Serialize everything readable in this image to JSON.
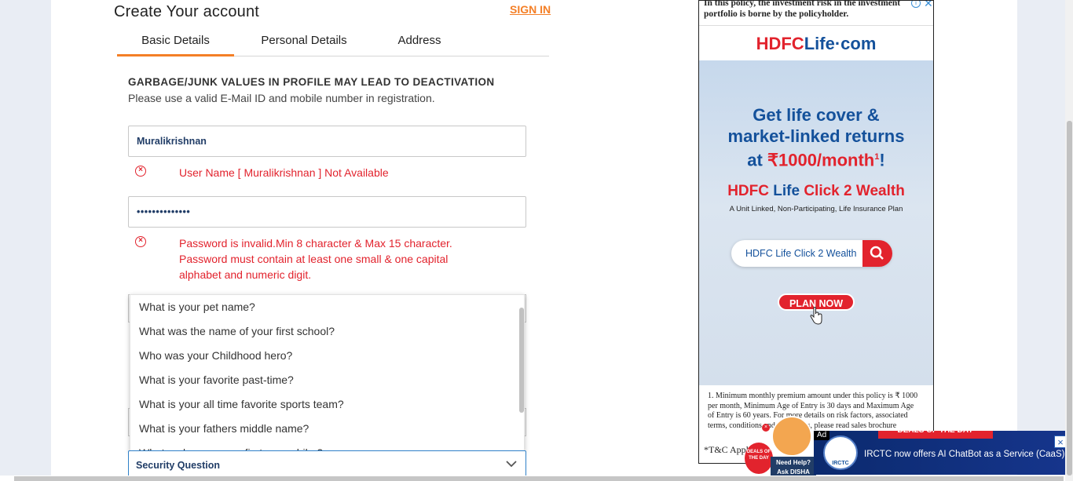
{
  "header": {
    "title": "Create Your account",
    "signin_label": "SIGN IN"
  },
  "tabs": [
    {
      "label": "Basic Details",
      "active": true
    },
    {
      "label": "Personal Details",
      "active": false
    },
    {
      "label": "Address",
      "active": false
    }
  ],
  "notice": {
    "heading": "GARBAGE/JUNK VALUES IN PROFILE MAY LEAD TO DEACTIVATION",
    "subtext": "Please use a valid E-Mail ID and mobile number in registration."
  },
  "form": {
    "username_value": "Muralikrishnan",
    "username_error": "User Name [ Muralikrishnan ] Not Available",
    "password_value": "••••••••••••••",
    "password_error_lines": [
      "Password is invalid.Min 8 character & Max 15 character.",
      "Password must contain at least one small & one capital",
      "alphabet and numeric digit."
    ],
    "security_question_selected": "Security Question",
    "security_question_options": [
      "What is your pet name?",
      "What was the name of your first school?",
      "Who was your Childhood hero?",
      "What is your favorite past-time?",
      "What is your all time favorite sports team?",
      "What is your fathers middle name?",
      "What make was your first car or bike?"
    ]
  },
  "ad": {
    "disclaimer": "In this policy, the investment risk in the investment portfolio is borne by the policyholder.",
    "logo_hdfc": "HDFC",
    "logo_life": "Life",
    "logo_com": "·com",
    "headline_line1": "Get life cover &",
    "headline_line2": "market-linked returns",
    "headline_line3_prefix": "at",
    "headline_rs": "₹1000/month",
    "headline_sup": "1",
    "headline_suffix": "!",
    "brand_hdfc": "HDFC",
    "brand_life": "Life",
    "brand_click": "Click",
    "brand_2": "2",
    "brand_wealth": "Wealth",
    "plan_desc": "A Unit Linked, Non-Participating, Life Insurance Plan",
    "search_text": "HDFC Life Click 2 Wealth",
    "plan_button": "PLAN NOW",
    "footnote": "1. Minimum monthly premium amount under this policy is ₹ 1000 per month, Minimum Age of Entry is 30 days and Maximum Age of Entry is 60 years. For more details on risk factors, associated terms, conditions and exclusions, please read sales brochure",
    "tc": "*T&C Apply"
  },
  "disha": {
    "deal_text": "DEALS OF THE DAY",
    "label_line1": "Need Help?",
    "label_line2": "Ask DISHA"
  },
  "banner": {
    "ad_tag": "Ad",
    "deals": "DEALS OF THE DAY",
    "logo_text": "IRCTC",
    "text": "IRCTC now offers AI ChatBot as a Service (CaaS)"
  },
  "colors": {
    "accent": "#f47f26",
    "error": "#e2232d",
    "input_text": "#213d67",
    "focus_border": "#2f80c8"
  }
}
